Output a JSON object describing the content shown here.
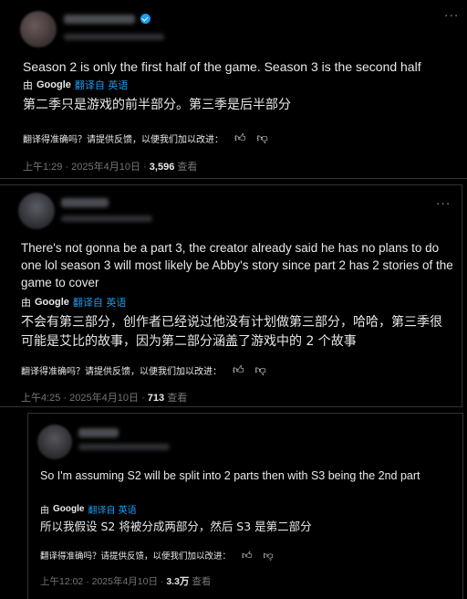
{
  "tweets": [
    {
      "text_en": "Season 2 is only the first half of the game. Season 3 is the second half",
      "by_label": "由",
      "google_label": "Google",
      "translated_from": "翻译自 英语",
      "text_zh": "第二季只是游戏的前半部分。第三季是后半部分",
      "feedback_prompt": "翻译得准确吗？请提供反馈，以便我们加以改进：",
      "time": "上午1:29 · 2025年4月10日 · ",
      "views_count": "3,596",
      "views_label": " 查看"
    },
    {
      "text_en": "There's not gonna be a part 3, the creator already said he has no plans to do one lol season 3 will most likely be Abby's story since part 2 has 2 stories of the game to cover",
      "by_label": "由",
      "google_label": "Google",
      "translated_from": "翻译自 英语",
      "text_zh": "不会有第三部分，创作者已经说过他没有计划做第三部分，哈哈，第三季很可能是艾比的故事，因为第二部分涵盖了游戏中的 2 个故事",
      "feedback_prompt": "翻译得准确吗？请提供反馈，以便我们加以改进：",
      "time": "上午4:25 · 2025年4月10日 · ",
      "views_count": "713",
      "views_label": " 查看"
    },
    {
      "text_en": "So I'm assuming S2 will be split into 2 parts then with S3 being the 2nd part",
      "by_label": "由",
      "google_label": "Google",
      "translated_from": "翻译自 英语",
      "text_zh": "所以我假设 S2 将被分成两部分，然后 S3 是第二部分",
      "feedback_prompt": "翻译得准确吗？请提供反馈，以便我们加以改进：",
      "time": "上午12:02 · 2025年4月10日 · ",
      "views_count": "3.3万",
      "views_label": " 查看"
    }
  ],
  "icons": {
    "more": "more-options-icon",
    "thumbs_up": "thumbs-up-icon",
    "thumbs_down": "thumbs-down-icon",
    "verified": "verified-badge-icon"
  },
  "colors": {
    "background": "#000000",
    "text": "#e7e9ea",
    "muted": "#71767b",
    "link": "#1d9bf0",
    "border": "#2f3336"
  }
}
